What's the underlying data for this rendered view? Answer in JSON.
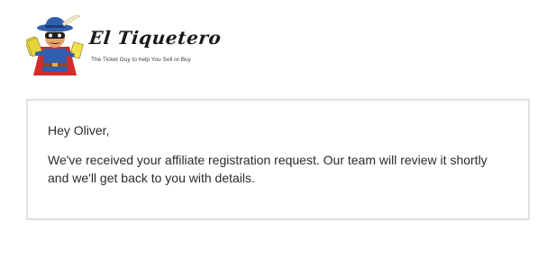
{
  "header": {
    "brand_name": "El Tiquetero",
    "tagline": "The Ticket Guy to help You Sell or Buy",
    "logo_icon": "masked-ticket-man-mascot-icon"
  },
  "message": {
    "greeting": "Hey Oliver,",
    "body": "We've received your affiliate registration request. Our team will review it shortly and we'll get back to you with details."
  },
  "colors": {
    "card_border": "#e0e0e0",
    "text": "#2a2a2a",
    "mascot_hat": "#2f5fae",
    "mascot_cape": "#d22b2b",
    "mascot_skin": "#e8a36a"
  }
}
